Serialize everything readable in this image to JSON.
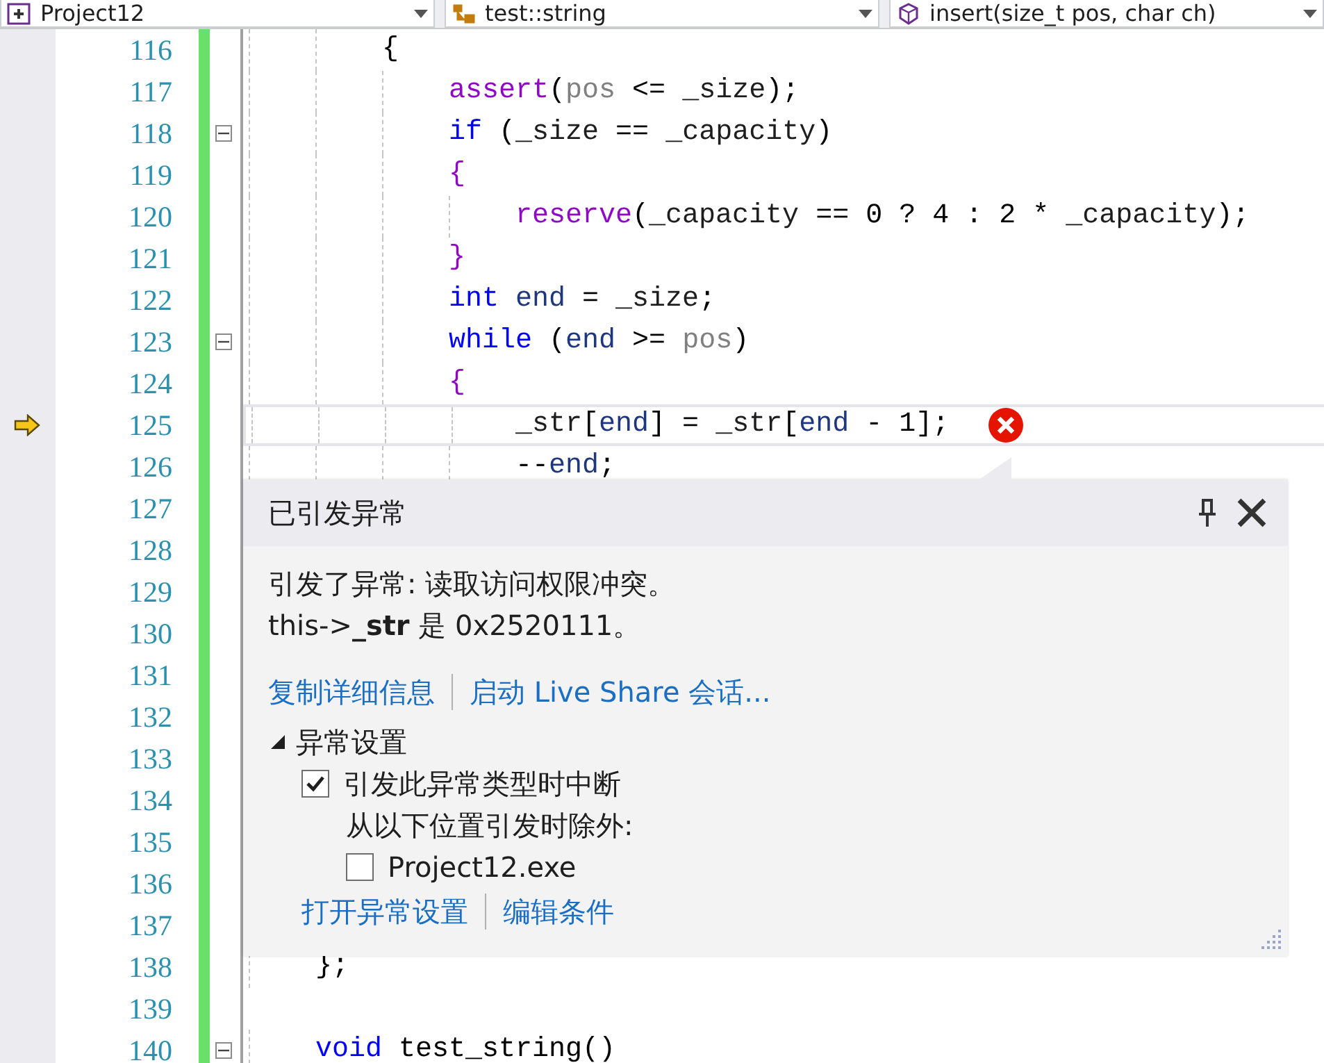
{
  "toolbar": {
    "dropdowns": [
      {
        "kind": "project",
        "label": "Project12"
      },
      {
        "kind": "class",
        "label": "test::string"
      },
      {
        "kind": "method",
        "label": "insert(size_t pos, char ch)"
      }
    ]
  },
  "editor": {
    "lines": [
      {
        "number": "116",
        "collapsible": false,
        "current": false,
        "error": false,
        "tokens": [
          {
            "kind": "plain",
            "text": "        {"
          }
        ]
      },
      {
        "number": "117",
        "collapsible": false,
        "current": false,
        "error": false,
        "tokens": [
          {
            "kind": "macro",
            "text": "            assert"
          },
          {
            "kind": "plain",
            "text": "("
          },
          {
            "kind": "param",
            "text": "pos"
          },
          {
            "kind": "plain",
            "text": " <= "
          },
          {
            "kind": "field",
            "text": "_size"
          },
          {
            "kind": "plain",
            "text": ");"
          }
        ]
      },
      {
        "number": "118",
        "collapsible": true,
        "current": false,
        "error": false,
        "tokens": [
          {
            "kind": "keyword",
            "text": "            if"
          },
          {
            "kind": "plain",
            "text": " ("
          },
          {
            "kind": "field",
            "text": "_size"
          },
          {
            "kind": "plain",
            "text": " == "
          },
          {
            "kind": "field",
            "text": "_capacity"
          },
          {
            "kind": "plain",
            "text": ")"
          }
        ]
      },
      {
        "number": "119",
        "collapsible": false,
        "current": false,
        "error": false,
        "tokens": [
          {
            "kind": "brace",
            "text": "            {"
          }
        ]
      },
      {
        "number": "120",
        "collapsible": false,
        "current": false,
        "error": false,
        "tokens": [
          {
            "kind": "function",
            "text": "                reserve"
          },
          {
            "kind": "plain",
            "text": "("
          },
          {
            "kind": "field",
            "text": "_capacity"
          },
          {
            "kind": "plain",
            "text": " == "
          },
          {
            "kind": "number",
            "text": "0"
          },
          {
            "kind": "plain",
            "text": " ? "
          },
          {
            "kind": "number",
            "text": "4"
          },
          {
            "kind": "plain",
            "text": " : "
          },
          {
            "kind": "number",
            "text": "2"
          },
          {
            "kind": "plain",
            "text": " * "
          },
          {
            "kind": "field",
            "text": "_capacity"
          },
          {
            "kind": "plain",
            "text": ");"
          }
        ]
      },
      {
        "number": "121",
        "collapsible": false,
        "current": false,
        "error": false,
        "tokens": [
          {
            "kind": "brace",
            "text": "            }"
          }
        ]
      },
      {
        "number": "122",
        "collapsible": false,
        "current": false,
        "error": false,
        "tokens": [
          {
            "kind": "keyword",
            "text": "            int"
          },
          {
            "kind": "local",
            "text": " end"
          },
          {
            "kind": "plain",
            "text": " = "
          },
          {
            "kind": "field",
            "text": "_size"
          },
          {
            "kind": "plain",
            "text": ";"
          }
        ]
      },
      {
        "number": "123",
        "collapsible": true,
        "current": false,
        "error": false,
        "tokens": [
          {
            "kind": "keyword",
            "text": "            while"
          },
          {
            "kind": "plain",
            "text": " ("
          },
          {
            "kind": "local",
            "text": "end"
          },
          {
            "kind": "plain",
            "text": " >= "
          },
          {
            "kind": "param",
            "text": "pos"
          },
          {
            "kind": "plain",
            "text": ")"
          }
        ]
      },
      {
        "number": "124",
        "collapsible": false,
        "current": false,
        "error": false,
        "tokens": [
          {
            "kind": "brace",
            "text": "            {"
          }
        ]
      },
      {
        "number": "125",
        "collapsible": false,
        "current": true,
        "error": true,
        "tokens": [
          {
            "kind": "field",
            "text": "                _str"
          },
          {
            "kind": "plain",
            "text": "["
          },
          {
            "kind": "local",
            "text": "end"
          },
          {
            "kind": "plain",
            "text": "] = "
          },
          {
            "kind": "field",
            "text": "_str"
          },
          {
            "kind": "plain",
            "text": "["
          },
          {
            "kind": "local",
            "text": "end"
          },
          {
            "kind": "plain",
            "text": " - "
          },
          {
            "kind": "number",
            "text": "1"
          },
          {
            "kind": "plain",
            "text": "];"
          }
        ]
      },
      {
        "number": "126",
        "collapsible": false,
        "current": false,
        "error": false,
        "tokens": [
          {
            "kind": "plain",
            "text": "                --"
          },
          {
            "kind": "local",
            "text": "end"
          },
          {
            "kind": "plain",
            "text": ";"
          }
        ]
      },
      {
        "number": "127",
        "collapsible": false,
        "current": false,
        "error": false
      },
      {
        "number": "128",
        "collapsible": false,
        "current": false,
        "error": false
      },
      {
        "number": "129",
        "collapsible": false,
        "current": false,
        "error": false
      },
      {
        "number": "130",
        "collapsible": false,
        "current": false,
        "error": false
      },
      {
        "number": "131",
        "collapsible": false,
        "current": false,
        "error": false
      },
      {
        "number": "132",
        "collapsible": false,
        "current": false,
        "error": false
      },
      {
        "number": "133",
        "collapsible": false,
        "current": false,
        "error": false
      },
      {
        "number": "134",
        "collapsible": false,
        "current": false,
        "error": false
      },
      {
        "number": "135",
        "collapsible": false,
        "current": false,
        "error": false
      },
      {
        "number": "136",
        "collapsible": false,
        "current": false,
        "error": false
      },
      {
        "number": "137",
        "collapsible": false,
        "current": false,
        "error": false
      },
      {
        "number": "138",
        "collapsible": false,
        "current": false,
        "error": false,
        "tokens": [
          {
            "kind": "plain",
            "text": "    };"
          }
        ]
      },
      {
        "number": "139",
        "collapsible": false,
        "current": false,
        "error": false
      },
      {
        "number": "140",
        "collapsible": true,
        "current": false,
        "error": false,
        "tokens": [
          {
            "kind": "keyword",
            "text": "    void"
          },
          {
            "kind": "plain",
            "text": " test_string()"
          }
        ]
      }
    ]
  },
  "exception_popup": {
    "title": "已引发异常",
    "message_lines": [
      "引发了异常: 读取访问权限冲突。",
      "this->**_str** 是 0x2520111。"
    ],
    "links": [
      "复制详细信息",
      "启动 Live Share 会话..."
    ],
    "settings": {
      "title": "异常设置",
      "expanded": true,
      "options": [
        {
          "label": "引发此异常类型时中断",
          "checked": true
        }
      ],
      "except_label": "从以下位置引发时除外:",
      "modules": [
        {
          "label": "Project12.exe",
          "checked": false
        }
      ]
    },
    "footer_links": [
      "打开异常设置",
      "编辑条件"
    ]
  }
}
